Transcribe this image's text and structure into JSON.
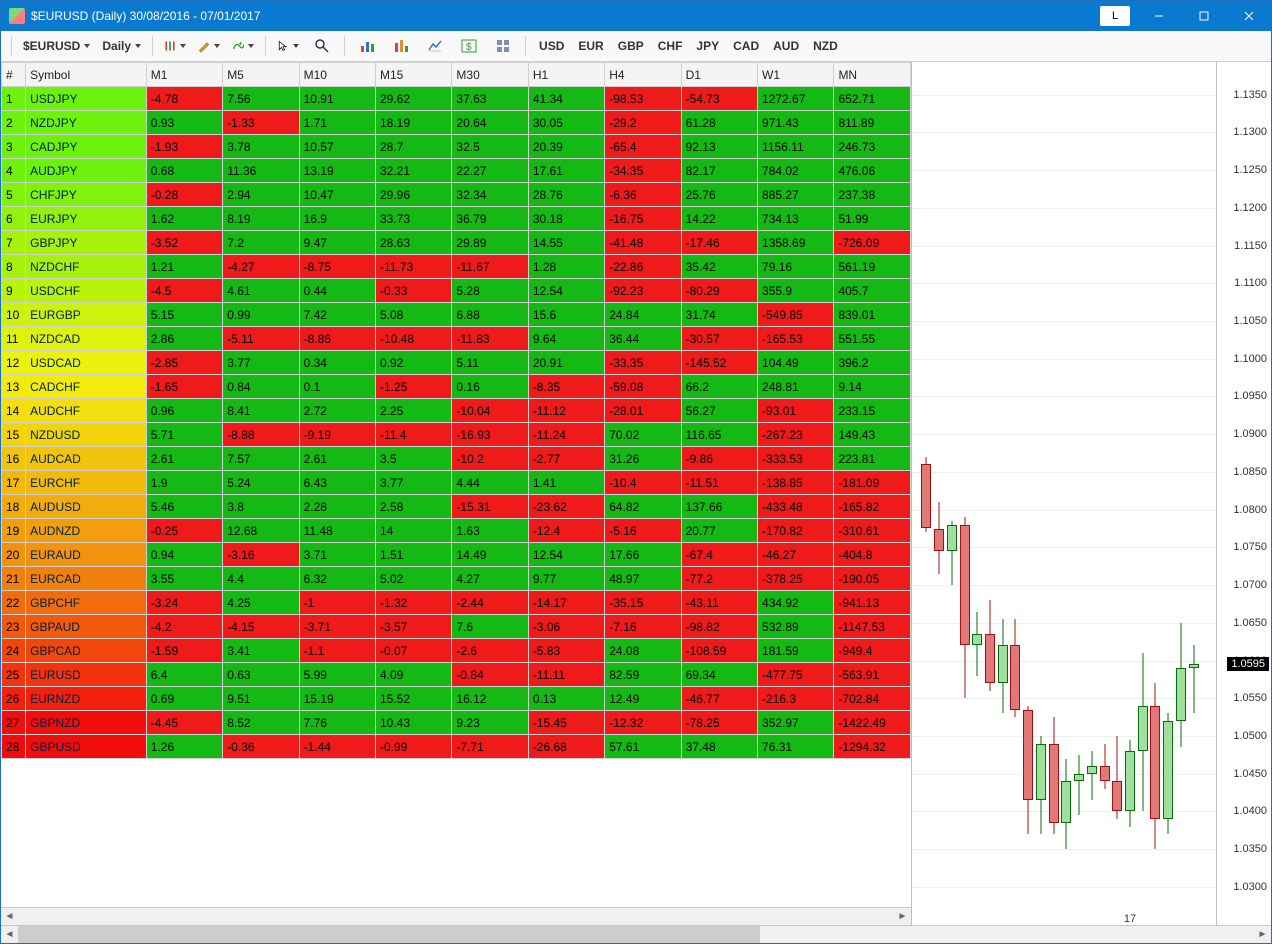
{
  "title": "$EURUSD (Daily)  30/08/2016 - 07/01/2017",
  "window_buttons": {
    "l": "L"
  },
  "toolbar": {
    "symbol_dd": "$EURUSD",
    "period_dd": "Daily",
    "currencies": [
      "USD",
      "EUR",
      "GBP",
      "CHF",
      "JPY",
      "CAD",
      "AUD",
      "NZD"
    ]
  },
  "columns": [
    "#",
    "Symbol",
    "M1",
    "M5",
    "M10",
    "M15",
    "M30",
    "H1",
    "H4",
    "D1",
    "W1",
    "MN"
  ],
  "row_hues": [
    95,
    95,
    95,
    95,
    90,
    85,
    80,
    80,
    75,
    70,
    65,
    62,
    58,
    55,
    52,
    48,
    45,
    42,
    38,
    35,
    30,
    25,
    20,
    15,
    10,
    5,
    0,
    0
  ],
  "rows": [
    {
      "n": 1,
      "sym": "USDJPY",
      "v": [
        -4.78,
        7.56,
        10.91,
        29.62,
        37.63,
        41.34,
        -98.53,
        -54.73,
        1272.67,
        652.71
      ]
    },
    {
      "n": 2,
      "sym": "NZDJPY",
      "v": [
        0.93,
        -1.33,
        1.71,
        18.19,
        20.64,
        30.05,
        -29.2,
        61.28,
        971.43,
        811.89
      ]
    },
    {
      "n": 3,
      "sym": "CADJPY",
      "v": [
        -1.93,
        3.78,
        10.57,
        28.7,
        32.5,
        20.39,
        -65.4,
        92.13,
        1156.11,
        246.73
      ]
    },
    {
      "n": 4,
      "sym": "AUDJPY",
      "v": [
        0.68,
        11.36,
        13.19,
        32.21,
        22.27,
        17.61,
        -34.35,
        82.17,
        784.02,
        476.06
      ]
    },
    {
      "n": 5,
      "sym": "CHFJPY",
      "v": [
        -0.28,
        2.94,
        10.47,
        29.96,
        32.34,
        28.76,
        -6.36,
        25.76,
        885.27,
        237.38
      ]
    },
    {
      "n": 6,
      "sym": "EURJPY",
      "v": [
        1.62,
        8.19,
        16.9,
        33.73,
        36.79,
        30.18,
        -16.75,
        14.22,
        734.13,
        51.99
      ]
    },
    {
      "n": 7,
      "sym": "GBPJPY",
      "v": [
        -3.52,
        7.2,
        9.47,
        28.63,
        29.89,
        14.55,
        -41.48,
        -17.46,
        1358.69,
        -726.09
      ]
    },
    {
      "n": 8,
      "sym": "NZDCHF",
      "v": [
        1.21,
        -4.27,
        -8.75,
        -11.73,
        -11.67,
        1.28,
        -22.86,
        35.42,
        79.16,
        561.19
      ]
    },
    {
      "n": 9,
      "sym": "USDCHF",
      "v": [
        -4.5,
        4.61,
        0.44,
        -0.33,
        5.28,
        12.54,
        -92.23,
        -80.29,
        355.9,
        405.7
      ]
    },
    {
      "n": 10,
      "sym": "EURGBP",
      "v": [
        5.15,
        0.99,
        7.42,
        5.08,
        6.88,
        15.6,
        24.84,
        31.74,
        -549.85,
        839.01
      ]
    },
    {
      "n": 11,
      "sym": "NZDCAD",
      "v": [
        2.86,
        -5.11,
        -8.86,
        -10.48,
        -11.83,
        9.64,
        36.44,
        -30.57,
        -165.53,
        551.55
      ]
    },
    {
      "n": 12,
      "sym": "USDCAD",
      "v": [
        -2.85,
        3.77,
        0.34,
        0.92,
        5.11,
        20.91,
        -33.35,
        -145.52,
        104.49,
        396.2
      ]
    },
    {
      "n": 13,
      "sym": "CADCHF",
      "v": [
        -1.65,
        0.84,
        0.1,
        -1.25,
        0.16,
        -8.35,
        -59.08,
        66.2,
        248.81,
        9.14
      ]
    },
    {
      "n": 14,
      "sym": "AUDCHF",
      "v": [
        0.96,
        8.41,
        2.72,
        2.25,
        -10.04,
        -11.12,
        -28.01,
        56.27,
        -93.01,
        233.15
      ]
    },
    {
      "n": 15,
      "sym": "NZDUSD",
      "v": [
        5.71,
        -8.88,
        -9.19,
        -11.4,
        -16.93,
        -11.24,
        70.02,
        116.65,
        -267.23,
        149.43
      ]
    },
    {
      "n": 16,
      "sym": "AUDCAD",
      "v": [
        2.61,
        7.57,
        2.61,
        3.5,
        -10.2,
        -2.77,
        31.26,
        -9.86,
        -333.53,
        223.81
      ]
    },
    {
      "n": 17,
      "sym": "EURCHF",
      "v": [
        1.9,
        5.24,
        6.43,
        3.77,
        4.44,
        1.41,
        -10.4,
        -11.51,
        -138.85,
        -181.09
      ]
    },
    {
      "n": 18,
      "sym": "AUDUSD",
      "v": [
        5.46,
        3.8,
        2.28,
        2.58,
        -15.31,
        -23.62,
        64.82,
        137.66,
        -433.48,
        -165.82
      ]
    },
    {
      "n": 19,
      "sym": "AUDNZD",
      "v": [
        -0.25,
        12.68,
        11.48,
        14,
        1.63,
        -12.4,
        -5.16,
        20.77,
        -170.82,
        -310.61
      ]
    },
    {
      "n": 20,
      "sym": "EURAUD",
      "v": [
        0.94,
        -3.16,
        3.71,
        1.51,
        14.49,
        12.54,
        17.66,
        -67.4,
        -46.27,
        -404.8
      ]
    },
    {
      "n": 21,
      "sym": "EURCAD",
      "v": [
        3.55,
        4.4,
        6.32,
        5.02,
        4.27,
        9.77,
        48.97,
        -77.2,
        -378.25,
        -190.05
      ]
    },
    {
      "n": 22,
      "sym": "GBPCHF",
      "v": [
        -3.24,
        4.25,
        -1,
        -1.32,
        -2.44,
        -14.17,
        -35.15,
        -43.11,
        434.92,
        -941.13
      ]
    },
    {
      "n": 23,
      "sym": "GBPAUD",
      "v": [
        -4.2,
        -4.15,
        -3.71,
        -3.57,
        7.6,
        -3.06,
        -7.16,
        -98.82,
        532.89,
        -1147.53
      ]
    },
    {
      "n": 24,
      "sym": "GBPCAD",
      "v": [
        -1.59,
        3.41,
        -1.1,
        -0.07,
        -2.6,
        -5.83,
        24.08,
        -108.59,
        181.59,
        -949.4
      ]
    },
    {
      "n": 25,
      "sym": "EURUSD",
      "v": [
        6.4,
        0.63,
        5.99,
        4.09,
        -0.84,
        -11.11,
        82.59,
        69.34,
        -477.75,
        -563.91
      ]
    },
    {
      "n": 26,
      "sym": "EURNZD",
      "v": [
        0.69,
        9.51,
        15.19,
        15.52,
        16.12,
        0.13,
        12.49,
        -46.77,
        -216.3,
        -702.84
      ]
    },
    {
      "n": 27,
      "sym": "GBPNZD",
      "v": [
        -4.45,
        8.52,
        7.76,
        10.43,
        9.23,
        -15.45,
        -12.32,
        -78.25,
        352.97,
        -1422.49
      ]
    },
    {
      "n": 28,
      "sym": "GBPUSD",
      "v": [
        1.26,
        -0.36,
        -1.44,
        -0.99,
        -7.71,
        -26.68,
        57.61,
        37.48,
        76.31,
        -1294.32
      ]
    }
  ],
  "chart_data": {
    "type": "candlestick",
    "title": "$EURUSD (Daily)",
    "ylim": [
      1.028,
      1.138
    ],
    "yticks": [
      1.03,
      1.035,
      1.04,
      1.045,
      1.05,
      1.055,
      1.06,
      1.065,
      1.07,
      1.075,
      1.08,
      1.085,
      1.09,
      1.095,
      1.1,
      1.105,
      1.11,
      1.115,
      1.12,
      1.125,
      1.13,
      1.135
    ],
    "last_price": 1.0595,
    "x_tick_label": "17",
    "candles": [
      {
        "o": 1.086,
        "h": 1.087,
        "l": 1.077,
        "c": 1.0775
      },
      {
        "o": 1.0775,
        "h": 1.081,
        "l": 1.0715,
        "c": 1.0745
      },
      {
        "o": 1.0745,
        "h": 1.0785,
        "l": 1.07,
        "c": 1.078
      },
      {
        "o": 1.078,
        "h": 1.079,
        "l": 1.055,
        "c": 1.062
      },
      {
        "o": 1.062,
        "h": 1.0665,
        "l": 1.058,
        "c": 1.0635
      },
      {
        "o": 1.0635,
        "h": 1.068,
        "l": 1.056,
        "c": 1.057
      },
      {
        "o": 1.057,
        "h": 1.0655,
        "l": 1.053,
        "c": 1.062
      },
      {
        "o": 1.062,
        "h": 1.0655,
        "l": 1.0525,
        "c": 1.0535
      },
      {
        "o": 1.0535,
        "h": 1.054,
        "l": 1.037,
        "c": 1.0415
      },
      {
        "o": 1.0415,
        "h": 1.05,
        "l": 1.037,
        "c": 1.049
      },
      {
        "o": 1.049,
        "h": 1.0525,
        "l": 1.037,
        "c": 1.0385
      },
      {
        "o": 1.0385,
        "h": 1.047,
        "l": 1.035,
        "c": 1.044
      },
      {
        "o": 1.044,
        "h": 1.0475,
        "l": 1.0395,
        "c": 1.045
      },
      {
        "o": 1.045,
        "h": 1.048,
        "l": 1.0415,
        "c": 1.046
      },
      {
        "o": 1.046,
        "h": 1.049,
        "l": 1.043,
        "c": 1.044
      },
      {
        "o": 1.044,
        "h": 1.05,
        "l": 1.039,
        "c": 1.04
      },
      {
        "o": 1.04,
        "h": 1.0495,
        "l": 1.038,
        "c": 1.048
      },
      {
        "o": 1.048,
        "h": 1.061,
        "l": 1.04,
        "c": 1.054
      },
      {
        "o": 1.054,
        "h": 1.057,
        "l": 1.035,
        "c": 1.039
      },
      {
        "o": 1.039,
        "h": 1.053,
        "l": 1.037,
        "c": 1.052
      },
      {
        "o": 1.052,
        "h": 1.065,
        "l": 1.0485,
        "c": 1.059
      },
      {
        "o": 1.059,
        "h": 1.062,
        "l": 1.053,
        "c": 1.0595
      }
    ]
  }
}
